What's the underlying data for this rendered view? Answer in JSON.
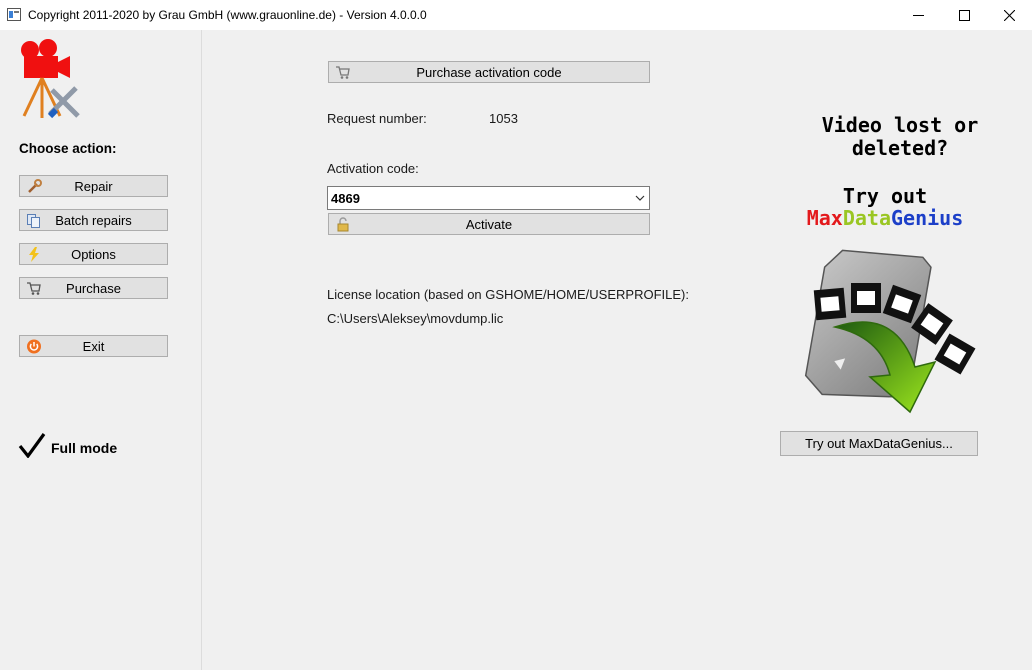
{
  "window": {
    "title": "Copyright 2011-2020 by Grau GmbH (www.grauonline.de) - Version 4.0.0.0",
    "minimize_icon": "minimize-icon",
    "maximize_icon": "maximize-icon",
    "close_icon": "close-icon"
  },
  "sidebar": {
    "choose_label": "Choose action:",
    "buttons": [
      {
        "label": "Repair",
        "icon": "wrench-icon"
      },
      {
        "label": "Batch repairs",
        "icon": "documents-icon"
      },
      {
        "label": "Options",
        "icon": "lightning-icon"
      },
      {
        "label": "Purchase",
        "icon": "cart-icon"
      },
      {
        "label": "Exit",
        "icon": "power-icon"
      }
    ],
    "mode_label": "Full mode"
  },
  "main": {
    "purchase_button": "Purchase activation code",
    "request_label": "Request number:",
    "request_value": "1053",
    "activation_label": "Activation code:",
    "activation_value": "4869",
    "activate_button": "Activate",
    "license_label": "License location (based on GSHOME/HOME/USERPROFILE):",
    "license_path": "C:\\Users\\Aleksey\\movdump.lic"
  },
  "promo": {
    "line1": "Video lost or",
    "line2": "deleted?",
    "line3": "Try out",
    "brand_part1": "Max",
    "brand_part2": "Data",
    "brand_part3": "Genius",
    "button": "Try out MaxDataGenius..."
  },
  "colors": {
    "brand_red": "#e3191c",
    "brand_green": "#9ac623",
    "brand_blue": "#1c3fc8"
  }
}
